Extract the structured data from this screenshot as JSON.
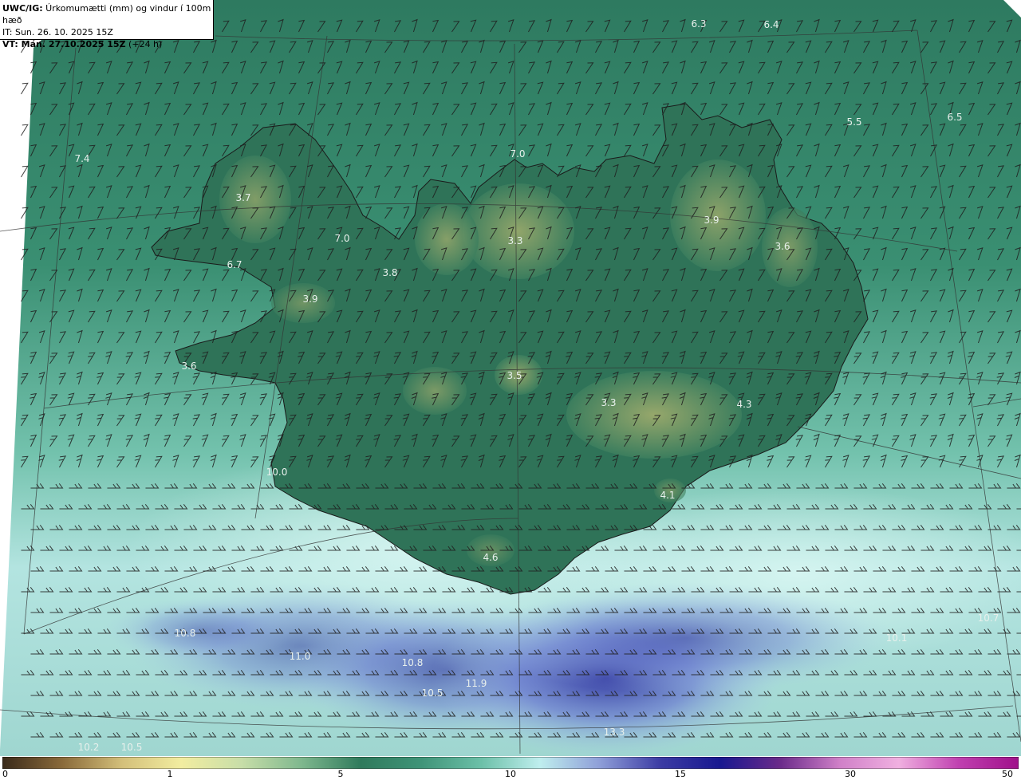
{
  "header": {
    "prefix": "UWC/IG:",
    "title": " Úrkomumætti (mm) og vindur í 100m hæð",
    "it_line": "IT: Sun. 26. 10. 2025 15Z",
    "vt_bold": "VT: Mán. 27.10.2025 15Z",
    "vt_rest": " (+24 h)"
  },
  "colorbar": {
    "ticks": [
      "0",
      "1",
      "5",
      "10",
      "15",
      "30",
      "50"
    ],
    "colors": [
      "#3a2a1a",
      "#8a6a3a",
      "#d4c07a",
      "#f2eda0",
      "#c8dea8",
      "#7fb88e",
      "#2f7a5c",
      "#3f9478",
      "#6cc0a8",
      "#bfeeee",
      "#8e9ed8",
      "#3c3ca4",
      "#181890",
      "#6a2a8a",
      "#d080c8",
      "#f0b0e0",
      "#c040b0",
      "#a0108a"
    ]
  },
  "labels": [
    "6.3",
    "6.4",
    "5.5",
    "6.5",
    "7.4",
    "7.0",
    "3.7",
    "7.0",
    "3.9",
    "3.3",
    "3.6",
    "6.7",
    "3.8",
    "3.9",
    "3.6",
    "3.5",
    "3.3",
    "4.3",
    "10.0",
    "4.1",
    "4.6",
    "10.7",
    "10.8",
    "10.1",
    "11.0",
    "10.8",
    "11.9",
    "10.5",
    "13.3",
    "10.2",
    "10.5"
  ],
  "map": {
    "ocean_colors": [
      "#2f7a62",
      "#3f9878",
      "#b9e6e2",
      "#6a7ad0",
      "#3a3aa8"
    ],
    "land_colors": [
      "#2d6e54",
      "#8ea86a"
    ]
  }
}
